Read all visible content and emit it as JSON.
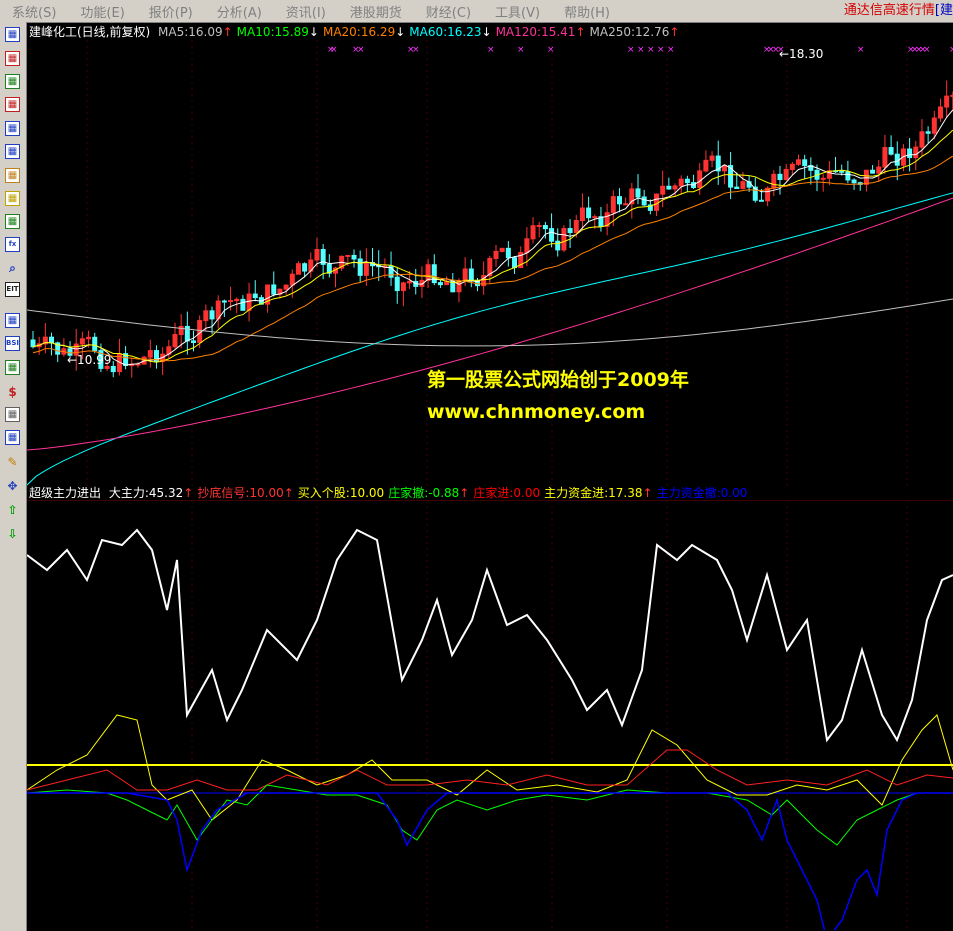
{
  "menu": {
    "items": [
      "系统(S)",
      "功能(E)",
      "报价(P)",
      "分析(A)",
      "资讯(I)",
      "港股期货",
      "财经(C)",
      "工具(V)",
      "帮助(H)"
    ],
    "app_title": "通达信高速行情",
    "app_title_suffix": "[建"
  },
  "toolbar": {
    "icons": [
      "quote-list-icon",
      "chart-icon",
      "line-chart-icon",
      "kline-icon",
      "table-icon",
      "grid-icon",
      "report-icon",
      "folder-icon",
      "users-icon",
      "fx-icon",
      "search-icon",
      "eit-icon",
      "trend-icon",
      "bsi-icon",
      "news-icon",
      "money-icon",
      "pen-link-icon",
      "export-icon",
      "pencil-icon",
      "move-icon",
      "arrow-up-icon",
      "arrow-down-icon"
    ],
    "labels": {
      "eit": "EIT",
      "bsi": "BSI",
      "fx": "fx"
    }
  },
  "main_legend": {
    "name": "建峰化工(日线,前复权)",
    "items": [
      {
        "label": "MA5:16.09",
        "arrow": "↑",
        "color": "#c0c0c0"
      },
      {
        "label": "MA10:15.89",
        "arrow": "↓",
        "color": "#00ff00"
      },
      {
        "label": "MA20:16.29",
        "arrow": "↓",
        "color": "#ff8000"
      },
      {
        "label": "MA60:16.23",
        "arrow": "↓",
        "color": "#00ffff"
      },
      {
        "label": "MA120:15.41",
        "arrow": "↑",
        "color": "#ff3399"
      },
      {
        "label": "MA250:12.76",
        "arrow": "↑",
        "color": "#c0c0c0"
      }
    ]
  },
  "price_labels": {
    "high": "18.30",
    "low": "10.99"
  },
  "watermark": {
    "line1": "第一股票公式网始创于2009年",
    "line2": "www.chnmoney.com"
  },
  "indicator_legend": {
    "name": "超级主力进出",
    "items": [
      {
        "label": "大主力:45.32",
        "arrow": "↑",
        "color": "#ffffff"
      },
      {
        "label": "抄底信号:10.00",
        "arrow": "↑",
        "color": "#ff3333"
      },
      {
        "label": "买入个股:10.00",
        "arrow": "",
        "color": "#ffff00"
      },
      {
        "label": "庄家撤:-0.88",
        "arrow": "↑",
        "color": "#00ff00"
      },
      {
        "label": "庄家进:0.00",
        "arrow": "",
        "color": "#ff0000"
      },
      {
        "label": "主力资金进:17.38",
        "arrow": "↑",
        "color": "#ffff00"
      },
      {
        "label": "主力资金撤:0.00",
        "arrow": "",
        "color": "#0000ff"
      }
    ]
  },
  "colors": {
    "up": "#ff3232",
    "down": "#54ffff",
    "ma5": "#ffffff",
    "ma10": "#ffff00",
    "ma20": "#ff8000",
    "ma60": "#00ffff",
    "ma120": "#ff3399",
    "ma250": "#c0c0c0"
  }
}
